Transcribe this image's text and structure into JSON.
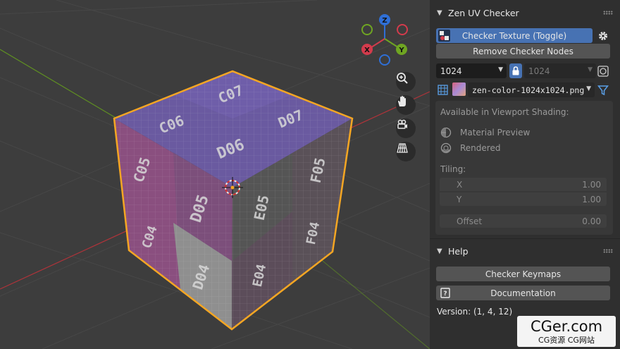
{
  "viewport": {
    "cube_labels": {
      "top_back": "C07",
      "top_left": "C06",
      "top_right": "D07",
      "top_front": "D06",
      "left_col1_upper": "C05",
      "left_col1_lower": "C04",
      "left_col2_upper": "D05",
      "left_col2_lower": "D04",
      "right_col1_upper": "E05",
      "right_col1_lower": "E04",
      "right_col2_upper": "F05",
      "right_col2_lower": "F04"
    },
    "gizmo": {
      "z": "Z",
      "x": "X",
      "y": "Y"
    },
    "nav_icons": [
      "zoom-icon",
      "hand-icon",
      "camera-icon",
      "grid-icon"
    ]
  },
  "panel": {
    "section_title": "Zen UV Checker",
    "checker_toggle_label": "Checker Texture (Toggle)",
    "remove_nodes_label": "Remove Checker Nodes",
    "resolution_value": "1024",
    "resolution_locked_value": "1024",
    "texture_file": "zen-color-1024x1024.png",
    "available_label": "Available in Viewport Shading:",
    "material_preview_label": "Material Preview",
    "rendered_label": "Rendered",
    "tiling_label": "Tiling:",
    "x_label": "X",
    "x_value": "1.00",
    "y_label": "Y",
    "y_value": "1.00",
    "offset_label": "Offset",
    "offset_value": "0.00",
    "help_title": "Help",
    "keymaps_label": "Checker Keymaps",
    "documentation_label": "Documentation",
    "version_text": "Version: (1, 4, 12)"
  },
  "watermark": {
    "main": "CGer.com",
    "sub": "CG资源 CG网站"
  },
  "colors": {
    "panel_bg": "#2f2f2f",
    "viewport_bg": "#3d3d3d",
    "accent_blue": "#4772b3",
    "selection_orange": "#f5a623",
    "axis_red": "#b0333a",
    "axis_green": "#5f8f22"
  }
}
